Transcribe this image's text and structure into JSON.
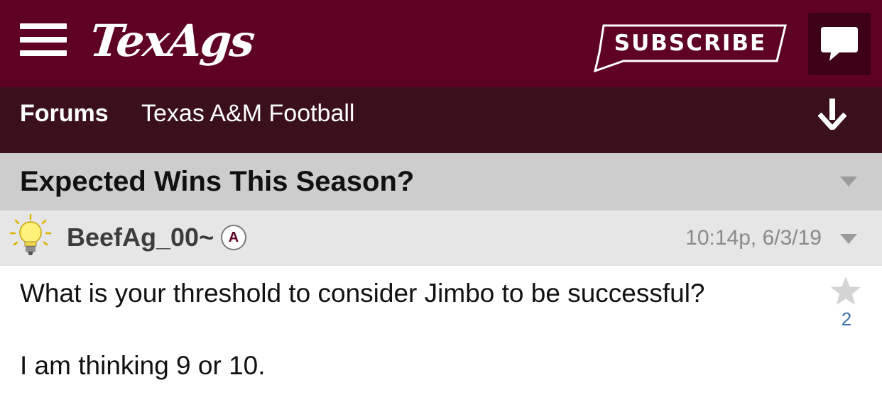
{
  "header": {
    "logo_text": "TexAgs",
    "subscribe_label": "SUBSCRIBE",
    "icons": [
      "menu-icon",
      "chat-icon"
    ],
    "brand_color": "#5f0025"
  },
  "nav": {
    "forums_label": "Forums",
    "forum_name": "Texas A&M Football",
    "icons": [
      "download-arrow-icon"
    ]
  },
  "thread": {
    "title": "Expected Wins This Season?"
  },
  "post": {
    "username": "BeefAg_00~",
    "badge": "A",
    "timestamp": "10:14p, 6/3/19",
    "line1": "What is your threshold to consider Jimbo to be successful?",
    "line2": "I am thinking 9 or 10.",
    "star_count": "2",
    "icons": [
      "lightbulb-icon",
      "star-icon",
      "chevron-down-icon"
    ]
  }
}
